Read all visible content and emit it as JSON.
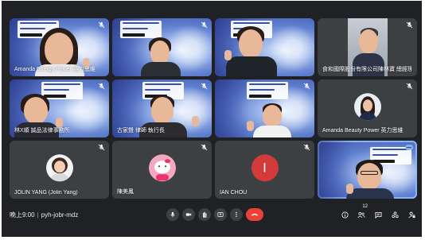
{
  "participants": [
    {
      "name": "Amanda Energy Power 英力思維",
      "muted": true
    },
    {
      "name": "",
      "muted": true
    },
    {
      "name": "",
      "muted": false
    },
    {
      "name": "食和國際股份有限公司陳林寶 總經理",
      "muted": true
    },
    {
      "name": "林X順 誠品法律事務所",
      "muted": false
    },
    {
      "name": "古家聲 律師 執行長",
      "muted": true
    },
    {
      "name": "",
      "muted": true
    },
    {
      "name": "Amanda Beauty Power 英力思維",
      "muted": true
    },
    {
      "name": "JOLIN YANG (Jolin Yang)",
      "muted": true
    },
    {
      "name": "陳美鳳",
      "muted": true
    },
    {
      "name": "IAN CHOU",
      "muted": true
    },
    {
      "name": "",
      "muted": false
    }
  ],
  "avatars": {
    "ian_initial": "I",
    "ian_color": "#d33b3b"
  },
  "meeting": {
    "time": "晚上9:00",
    "code": "pyh-jobr-mdz"
  },
  "people_count": "12",
  "colors": {
    "end_call": "#ea4335",
    "background": "#202124",
    "tile": "#3c4043",
    "active_outline": "#8ab4f8"
  }
}
